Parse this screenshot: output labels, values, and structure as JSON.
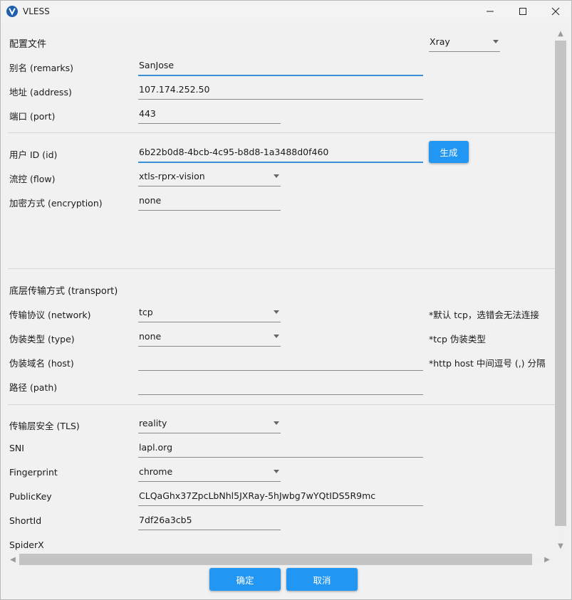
{
  "window": {
    "title": "VLESS"
  },
  "config": {
    "label": "配置文件",
    "core": "Xray"
  },
  "fields": {
    "remarks": {
      "label": "别名 (remarks)",
      "value": "SanJose"
    },
    "address": {
      "label": "地址 (address)",
      "value": "107.174.252.50"
    },
    "port": {
      "label": "端口 (port)",
      "value": "443"
    },
    "id": {
      "label": "用户 ID (id)",
      "value": "6b22b0d8-4bcb-4c95-b8d8-1a3488d0f460",
      "generate": "生成"
    },
    "flow": {
      "label": "流控 (flow)",
      "value": "xtls-rprx-vision"
    },
    "encryption": {
      "label": "加密方式 (encryption)",
      "value": "none"
    }
  },
  "transport": {
    "title": "底层传输方式 (transport)",
    "network": {
      "label": "传输协议 (network)",
      "value": "tcp",
      "hint": "*默认 tcp，选错会无法连接"
    },
    "type": {
      "label": "伪装类型 (type)",
      "value": "none",
      "hint": "*tcp 伪装类型"
    },
    "host": {
      "label": "伪装域名 (host)",
      "value": "",
      "hint": "*http host 中间逗号 (,) 分隔"
    },
    "path": {
      "label": "路径 (path)",
      "value": ""
    }
  },
  "tls": {
    "security": {
      "label": "传输层安全 (TLS)",
      "value": "reality"
    },
    "sni": {
      "label": "SNI",
      "value": "lapl.org"
    },
    "fingerprint": {
      "label": "Fingerprint",
      "value": "chrome"
    },
    "publickey": {
      "label": "PublicKey",
      "value": "CLQaGhx37ZpcLbNhl5JXRay-5hJwbg7wYQtIDS5R9mc"
    },
    "shortid": {
      "label": "ShortId",
      "value": "7df26a3cb5"
    },
    "spiderx": {
      "label": "SpiderX",
      "value": ""
    }
  },
  "footer": {
    "ok": "确定",
    "cancel": "取消"
  },
  "colors": {
    "accent": "#2196f3",
    "focus": "#3a8fd6"
  }
}
